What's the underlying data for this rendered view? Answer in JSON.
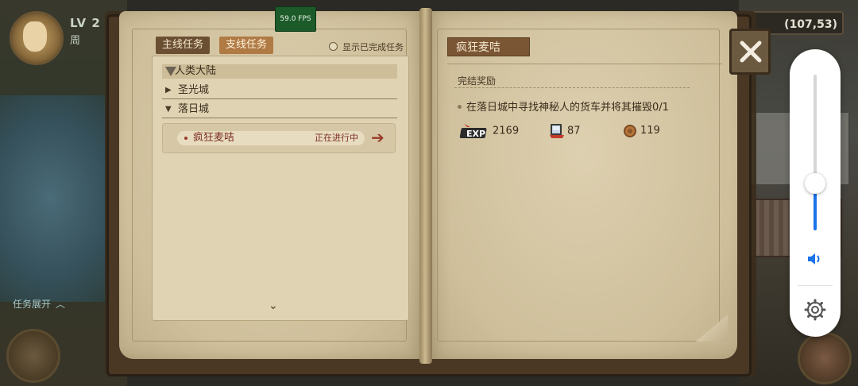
{
  "hud": {
    "level_text": "LV 2",
    "player_text": "周",
    "coords": "(107,53)",
    "task_expand": "任务展开",
    "fps": "59.0 FPS"
  },
  "left_page": {
    "tab_main": "主线任务",
    "tab_side": "支线任务",
    "show_completed": "显示已完成任务",
    "region": "人类大陆",
    "cities": [
      "圣光城",
      "落日城"
    ],
    "quest": {
      "name": "疯狂麦咭",
      "status": "正在进行中"
    }
  },
  "right_page": {
    "title": "疯狂麦咭",
    "reward_header": "完结奖励",
    "objective": "在落日城中寻找神秘人的货车并将其摧毁0/1",
    "rewards": {
      "exp": "2169",
      "card": "87",
      "coin": "119"
    }
  },
  "volume": {
    "level": 0.3
  },
  "colors": {
    "accent_blue": "#1a73e8",
    "quest_red": "#7a2e22",
    "tab_active": "#6b4f33",
    "tab_side": "#b07a45"
  },
  "icons": [
    "close-icon",
    "exp-icon",
    "card-icon",
    "coin-icon",
    "volume-icon",
    "gear-icon",
    "arrow-right-icon",
    "chevron-down-icon"
  ]
}
